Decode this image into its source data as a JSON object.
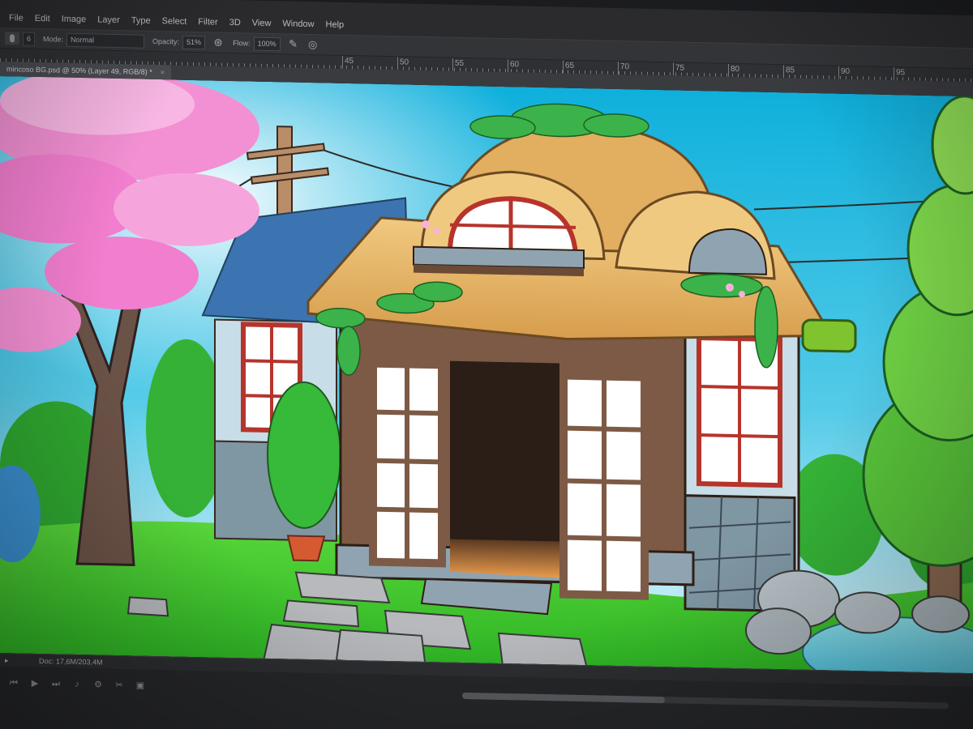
{
  "menu": {
    "items": [
      "File",
      "Edit",
      "Image",
      "Layer",
      "Type",
      "Select",
      "Filter",
      "3D",
      "View",
      "Window",
      "Help"
    ]
  },
  "options": {
    "brush_size": "6",
    "mode_label": "Mode:",
    "mode_value": "Normal",
    "opacity_label": "Opacity:",
    "opacity_value": "51%",
    "flow_label": "Flow:",
    "flow_value": "100%"
  },
  "ruler": {
    "labels": [
      "45",
      "50",
      "55",
      "60",
      "65",
      "70",
      "75",
      "80",
      "85",
      "90",
      "95"
    ]
  },
  "document": {
    "tab_title": "mincoso BG.psd @ 50% (Layer 49, RGB/8) *",
    "tab_close": "×"
  },
  "status": {
    "doc_info": "Doc: 17,6M/203,4M"
  },
  "icons": {
    "airbrush": "airbrush-icon",
    "pressure": "pressure-icon",
    "cut": "scissors-icon"
  },
  "colors": {
    "sky_top": "#16b3da",
    "sky_bottom": "#d8f4fb",
    "grass": "#3fc92e",
    "blossom": "#f27ecf",
    "thatch": "#e6b66a",
    "wood": "#7d5a45",
    "window_frame": "#b6342b",
    "stone": "#7f96a3"
  }
}
